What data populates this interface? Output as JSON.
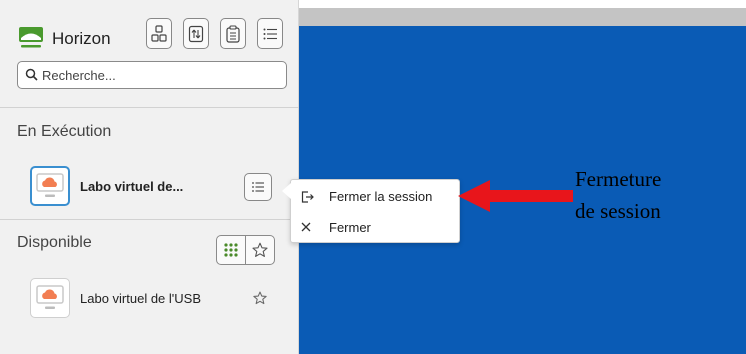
{
  "header": {
    "brand": "Horizon",
    "toolbar_icons": [
      "shortcuts-icon",
      "sort-icon",
      "clipboard-icon",
      "list-view-icon"
    ]
  },
  "search": {
    "placeholder": "Recherche..."
  },
  "sections": {
    "running": {
      "title": "En Exécution",
      "item_label": "Labo virtuel de...",
      "item_icon": "desktop-cloud-icon"
    },
    "available": {
      "title": "Disponible",
      "item_label": "Labo virtuel de l'USB",
      "item_icon": "desktop-cloud-icon"
    }
  },
  "context_menu": {
    "logout_label": "Fermer la session",
    "logout_icon": "logout-icon",
    "close_label": "Fermer",
    "close_icon": "close-icon"
  },
  "annotation": {
    "line1": "Fermeture",
    "line2": "de session"
  },
  "colors": {
    "remote_blue": "#0a5bb5",
    "accent_green": "#4a8a2a",
    "arrow_red": "#e8151b",
    "selected_border": "#3a8fd0"
  }
}
